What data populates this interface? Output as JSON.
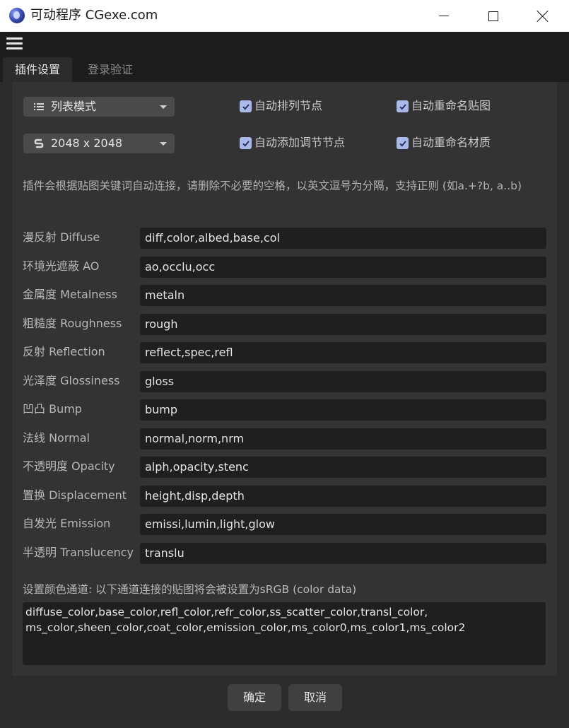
{
  "window": {
    "title": "可动程序 CGexe.com"
  },
  "tabs": [
    {
      "label": "插件设置",
      "active": true
    },
    {
      "label": "登录验证",
      "active": false
    }
  ],
  "controls": {
    "mode_dropdown": {
      "icon": "list-icon",
      "value": "列表模式"
    },
    "size_dropdown": {
      "icon": "s-logo-icon",
      "value": "2048 x 2048"
    },
    "checkboxes": [
      {
        "label": "自动排列节点",
        "checked": true
      },
      {
        "label": "自动重命名贴图",
        "checked": true
      },
      {
        "label": "自动添加调节节点",
        "checked": true
      },
      {
        "label": "自动重命名材质",
        "checked": true
      }
    ]
  },
  "hint": "插件会根据贴图关键词自动连接，请删除不必要的空格，以英文逗号为分隔，支持正则 (如a.+?b, a..b)",
  "keyword_rows": [
    {
      "label": "漫反射 Diffuse",
      "value": "diff,color,albed,base,col"
    },
    {
      "label": "环境光遮蔽 AO",
      "value": "ao,occlu,occ"
    },
    {
      "label": "金属度 Metalness",
      "value": "metaln"
    },
    {
      "label": "粗糙度 Roughness",
      "value": "rough"
    },
    {
      "label": "反射 Reflection",
      "value": "reflect,spec,refl"
    },
    {
      "label": "光泽度 Glossiness",
      "value": "gloss"
    },
    {
      "label": "凹凸 Bump",
      "value": "bump"
    },
    {
      "label": "法线 Normal",
      "value": "normal,norm,nrm"
    },
    {
      "label": "不透明度 Opacity",
      "value": "alph,opacity,stenc"
    },
    {
      "label": "置换 Displacement",
      "value": "height,disp,depth"
    },
    {
      "label": "自发光 Emission",
      "value": "emissi,lumin,light,glow"
    },
    {
      "label": "半透明 Translucency",
      "value": "translu"
    }
  ],
  "srgb": {
    "label": "设置颜色通道: 以下通道连接的贴图将会被设置为sRGB (color data)",
    "value": "diffuse_color,base_color,refl_color,refr_color,ss_scatter_color,transl_color,\nms_color,sheen_color,coat_color,emission_color,ms_color0,ms_color1,ms_color2"
  },
  "buttons": {
    "ok": "确定",
    "cancel": "取消"
  },
  "colors": {
    "checkbox": "#a9b9ec",
    "background": "#2b2b2b",
    "input": "#1f1f1f"
  }
}
